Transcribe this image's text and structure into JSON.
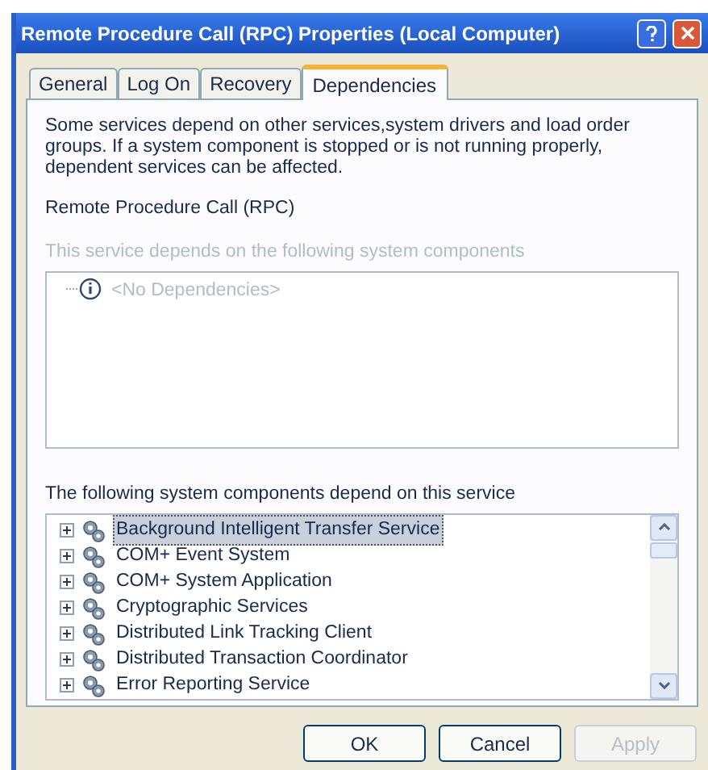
{
  "window": {
    "title": "Remote Procedure Call (RPC) Properties (Local Computer)"
  },
  "tabs": [
    {
      "label": "General",
      "selected": false
    },
    {
      "label": "Log On",
      "selected": false
    },
    {
      "label": "Recovery",
      "selected": false
    },
    {
      "label": "Dependencies",
      "selected": true
    }
  ],
  "description": "Some services depend on other services,system drivers and load order groups. If a system component is stopped or is not running properly, dependent services can be affected.",
  "service_name": "Remote Procedure Call (RPC)",
  "depends_on": {
    "label": "This service depends on the following system components",
    "disabled": true,
    "items": [
      {
        "label": "<No Dependencies>"
      }
    ]
  },
  "dependents": {
    "label": "The following system components depend on this service",
    "items": [
      {
        "label": "Background Intelligent Transfer Service",
        "selected": true
      },
      {
        "label": "COM+ Event System",
        "selected": false
      },
      {
        "label": "COM+ System Application",
        "selected": false
      },
      {
        "label": "Cryptographic Services",
        "selected": false
      },
      {
        "label": "Distributed Link Tracking Client",
        "selected": false
      },
      {
        "label": "Distributed Transaction Coordinator",
        "selected": false
      },
      {
        "label": "Error Reporting Service",
        "selected": false
      }
    ]
  },
  "buttons": [
    {
      "label": "OK",
      "disabled": false
    },
    {
      "label": "Cancel",
      "disabled": false
    },
    {
      "label": "Apply",
      "disabled": true
    }
  ]
}
